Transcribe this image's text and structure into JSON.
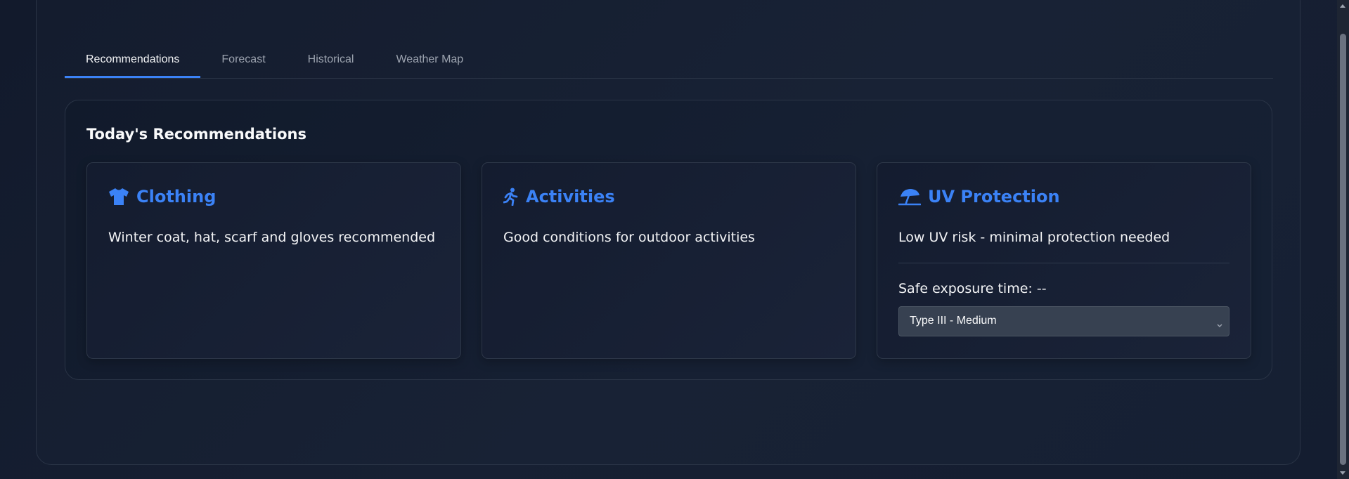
{
  "tabs": [
    {
      "label": "Recommendations",
      "active": true
    },
    {
      "label": "Forecast",
      "active": false
    },
    {
      "label": "Historical",
      "active": false
    },
    {
      "label": "Weather Map",
      "active": false
    }
  ],
  "recommendations": {
    "title": "Today's Recommendations",
    "clothing": {
      "icon": "shirt-icon",
      "title": "Clothing",
      "text": "Winter coat, hat, scarf and gloves recommended"
    },
    "activities": {
      "icon": "running-icon",
      "title": "Activities",
      "text": "Good conditions for outdoor activities"
    },
    "uv": {
      "icon": "umbrella-beach-icon",
      "title": "UV Protection",
      "text": "Low UV risk - minimal protection needed",
      "exposure_label": "Safe exposure time: --",
      "skin_type_selected": "Type III - Medium"
    }
  },
  "colors": {
    "accent": "#3b82f6",
    "background": "#111827"
  }
}
